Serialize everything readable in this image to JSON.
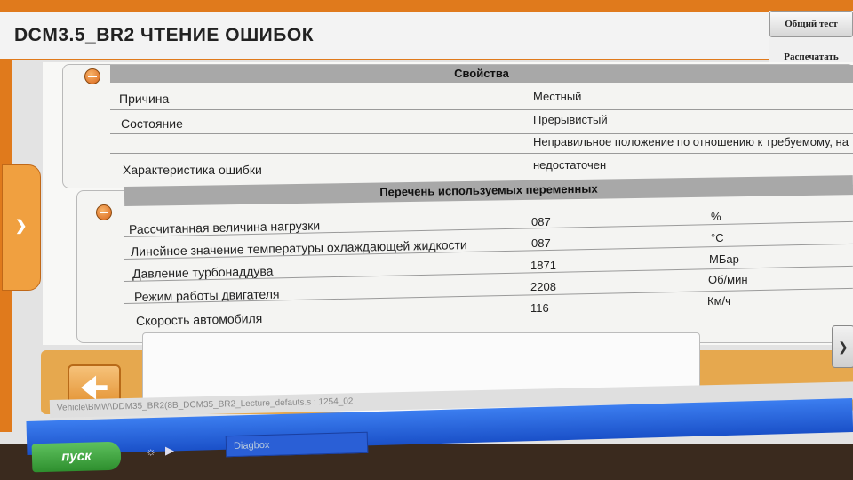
{
  "title": "DCM3.5_BR2  ЧТЕНИЕ ОШИБОК",
  "side_buttons": {
    "general_test": "Общий тест",
    "print": "Распечатать"
  },
  "properties": {
    "header": "Свойства",
    "rows": [
      {
        "label": "Причина",
        "value": "Местный"
      },
      {
        "label": "Состояние",
        "value": "Прерывистый"
      },
      {
        "label": "Характеристика ошибки",
        "value_line1": "Неправильное положение по отношению к требуемому, на",
        "value_line2": "недостаточен"
      }
    ]
  },
  "variables": {
    "header": "Перечень используемых переменных",
    "rows": [
      {
        "label": "Рассчитанная величина нагрузки",
        "value": "087",
        "unit": "%"
      },
      {
        "label": "Линейное значение температуры охлаждающей жидкости",
        "value": "087",
        "unit": "°C"
      },
      {
        "label": "Давление турбонаддува",
        "value": "1871",
        "unit": "МБар"
      },
      {
        "label": "Режим работы двигателя",
        "value": "2208",
        "unit": "Об/мин"
      },
      {
        "label": "Скорость автомобиля",
        "value": "116",
        "unit": "Км/ч"
      }
    ]
  },
  "status_bar": {
    "text": "Vehicle\\BMW\\DDM35_BR2(8B_DCM35_BR2_Lecture_defauts.s : 1254_02",
    "lang": "RL"
  },
  "taskbar": {
    "start_label": "пуск",
    "task_item": "Diagbox"
  },
  "icons": {
    "back": "back-arrow-icon",
    "expand": "chevron-right-icon",
    "collapse": "minus-icon"
  },
  "colors": {
    "accent": "#e07a1c",
    "section_header": "#a8a8a8",
    "taskbar": "#2a62d8",
    "start": "#3aa63a"
  }
}
